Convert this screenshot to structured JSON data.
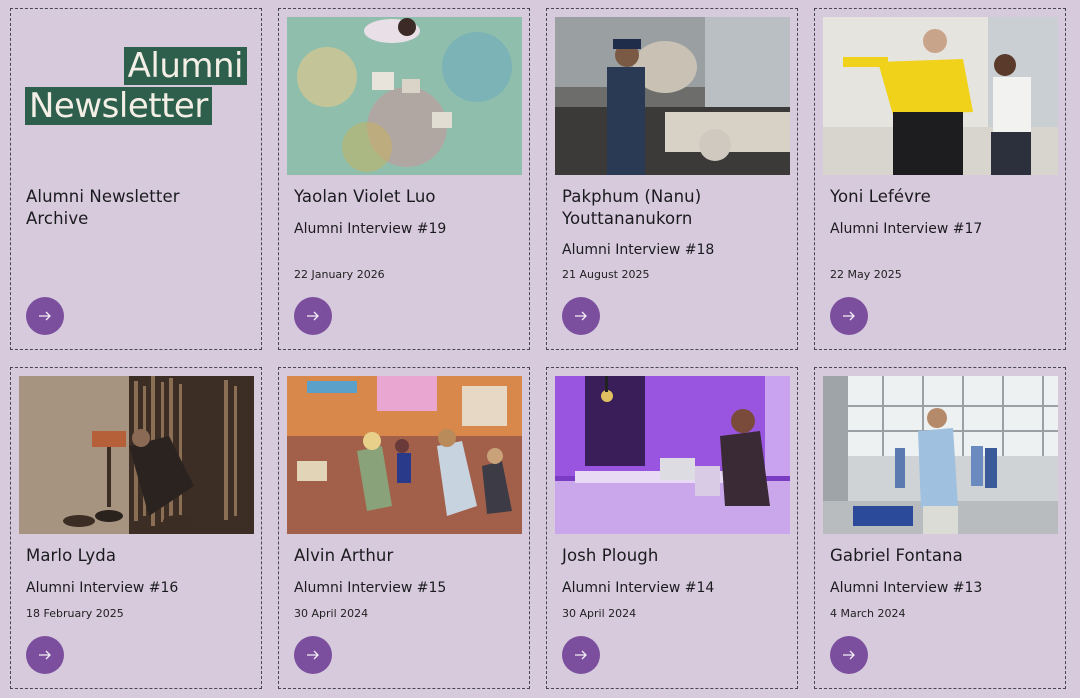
{
  "logo": {
    "line1": "Alumni",
    "line2": "Newsletter"
  },
  "archive": {
    "title": "Alumni Newsletter Archive"
  },
  "cards": [
    {
      "name": "Yaolan Violet Luo",
      "subtitle": "Alumni Interview #19",
      "date": "22 January 2026",
      "image_icon": "photo-children-painting"
    },
    {
      "name": "Pakphum (Nanu) Youttananukorn",
      "subtitle": "Alumni Interview #18",
      "date": "21 August 2025",
      "image_icon": "photo-pizza-oven"
    },
    {
      "name": "Yoni Lefévre",
      "subtitle": "Alumni Interview #17",
      "date": "22 May 2025",
      "image_icon": "photo-yellow-shirt"
    },
    {
      "name": "Marlo Lyda",
      "subtitle": "Alumni Interview #16",
      "date": "18 February 2025",
      "image_icon": "photo-lamp-studio"
    },
    {
      "name": "Alvin Arthur",
      "subtitle": "Alumni Interview #15",
      "date": "30 April 2024",
      "image_icon": "photo-classroom-dance"
    },
    {
      "name": "Josh Plough",
      "subtitle": "Alumni Interview #14",
      "date": "30 April 2024",
      "image_icon": "photo-purple-desk"
    },
    {
      "name": "Gabriel Fontana",
      "subtitle": "Alumni Interview #13",
      "date": "4 March 2024",
      "image_icon": "photo-clothing-studio"
    }
  ],
  "colors": {
    "background": "#d6cadc",
    "logo_bg": "#2e5e4c",
    "button": "#7b4f9e"
  },
  "arrow_icon": "arrow-right-icon"
}
